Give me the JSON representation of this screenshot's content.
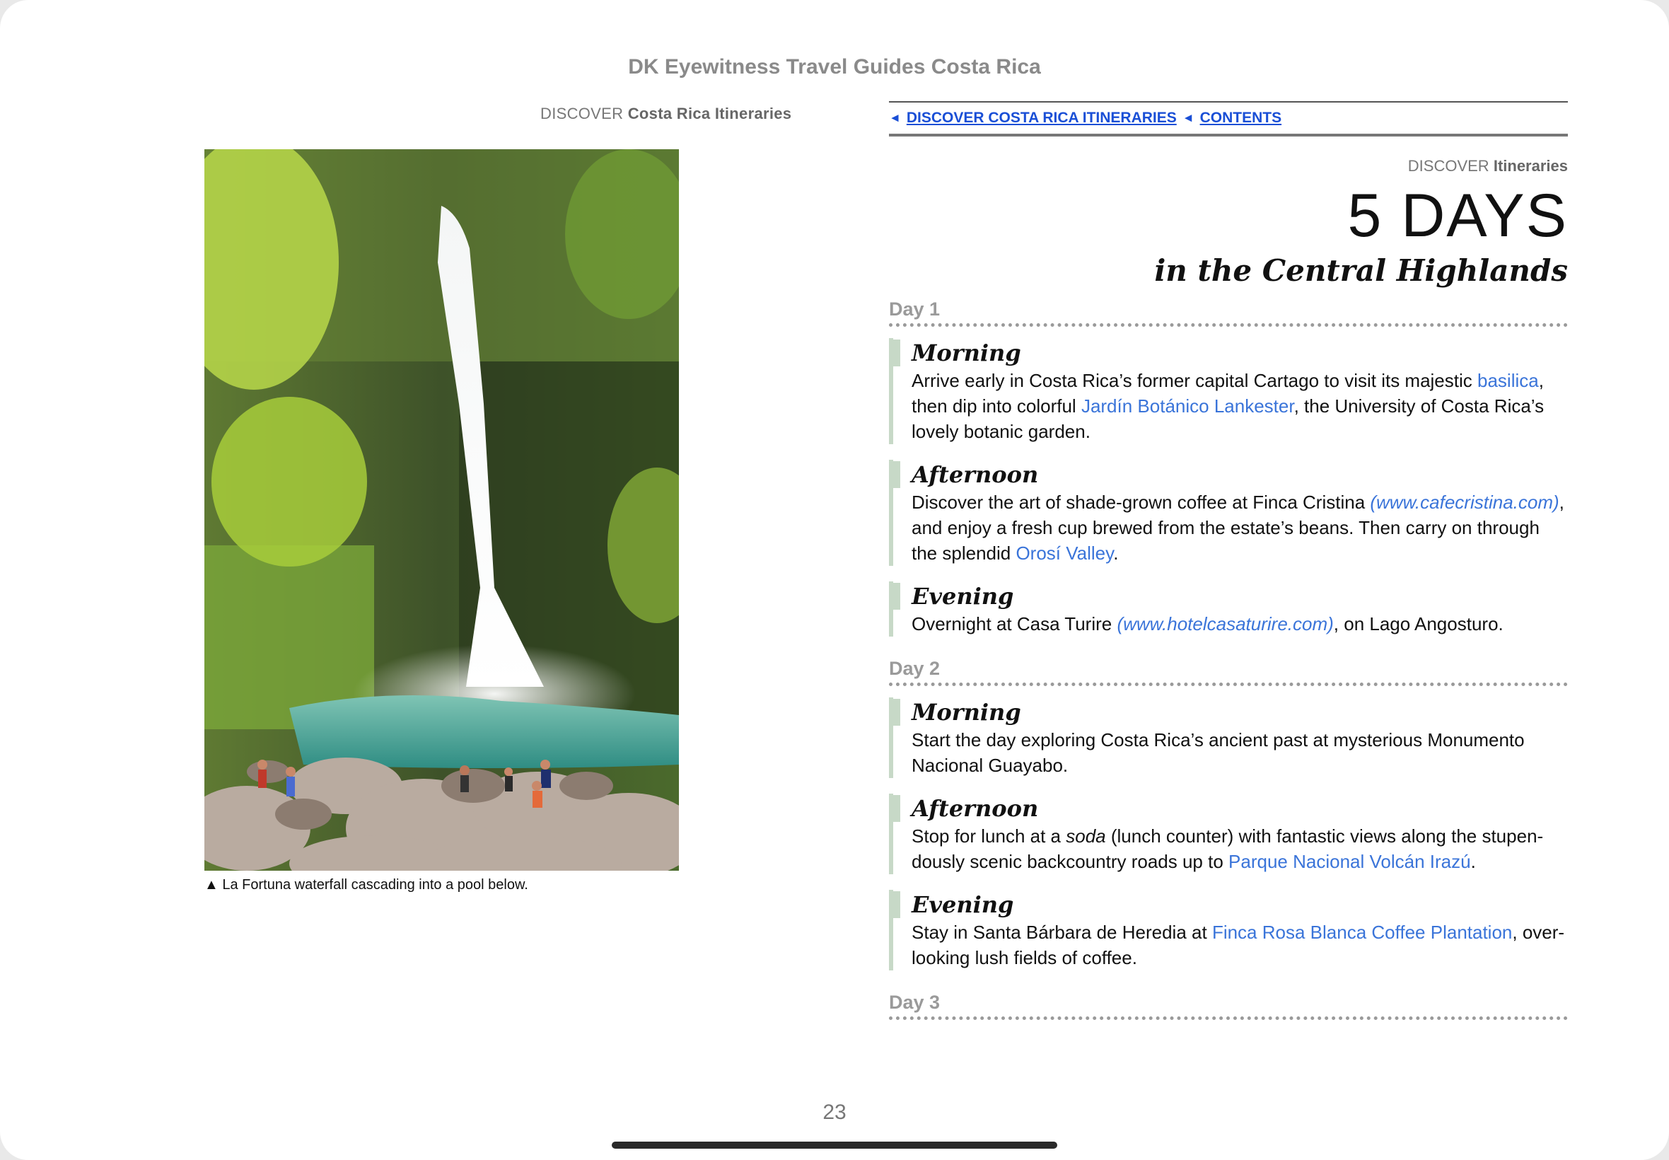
{
  "book_title": "DK Eyewitness Travel Guides Costa Rica",
  "left_page": {
    "header_section": "DISCOVER",
    "header_title": "Costa Rica Itineraries",
    "photo_icon": "waterfall-photo",
    "caption_marker": "▲",
    "caption": "La Fortuna waterfall cascading into a pool below."
  },
  "right_page": {
    "nav": {
      "link1_arrow": "◄",
      "link1": "DISCOVER COSTA RICA ITINERARIES",
      "link2_arrow": "◄",
      "link2": "CONTENTS"
    },
    "header_section": "DISCOVER",
    "header_title": "Itineraries",
    "title": "5 DAYS",
    "subtitle": "in the Central Highlands",
    "days": [
      {
        "label": "Day 1",
        "morning": {
          "title": "Morning",
          "t1": "Arrive early in Costa Rica’s former capital Cartago to visit its majestic ",
          "l1": "basilica",
          "t2": ", then dip into colorful ",
          "l2": "Jardín Botánico Lankester",
          "t3": ", the University of Costa Rica’s lovely botanic garden."
        },
        "afternoon": {
          "title": "Afternoon",
          "t1": "Discover the art of shade-grown coffee at Finca Cristina ",
          "u1": "(www.cafecristina.com)",
          "t2": ", and enjoy a fresh cup brewed from the estate’s beans. Then carry on through the splendid ",
          "l1": "Orosí Valley",
          "t3": "."
        },
        "evening": {
          "title": "Evening",
          "t1": "Overnight at Casa Turire ",
          "u1": "(www.hotelcasaturire.com)",
          "t2": ", on Lago Angosturo."
        }
      },
      {
        "label": "Day 2",
        "morning": {
          "title": "Morning",
          "t1": "Start the day exploring Costa Rica’s ancient past at mysterious Monumento Nacional Guayabo."
        },
        "afternoon": {
          "title": "Afternoon",
          "t1": "Stop for lunch at a ",
          "em": "soda",
          "t2": " (lunch counter) with fantastic views along the stupen­dously scenic backcountry roads up to ",
          "l1": "Parque Nacional Volcán Irazú",
          "t3": "."
        },
        "evening": {
          "title": "Evening",
          "t1": "Stay in Santa Bárbara de Heredia at ",
          "l1": "Finca Rosa Blanca Coffee Plantation",
          "t2": ", over­looking lush fields of coffee."
        }
      },
      {
        "label": "Day 3"
      }
    ]
  },
  "page_number": "23",
  "colors": {
    "link": "#3a74d9",
    "nav_link": "#1a4fd6",
    "accent_bar": "#c7d9c7"
  }
}
